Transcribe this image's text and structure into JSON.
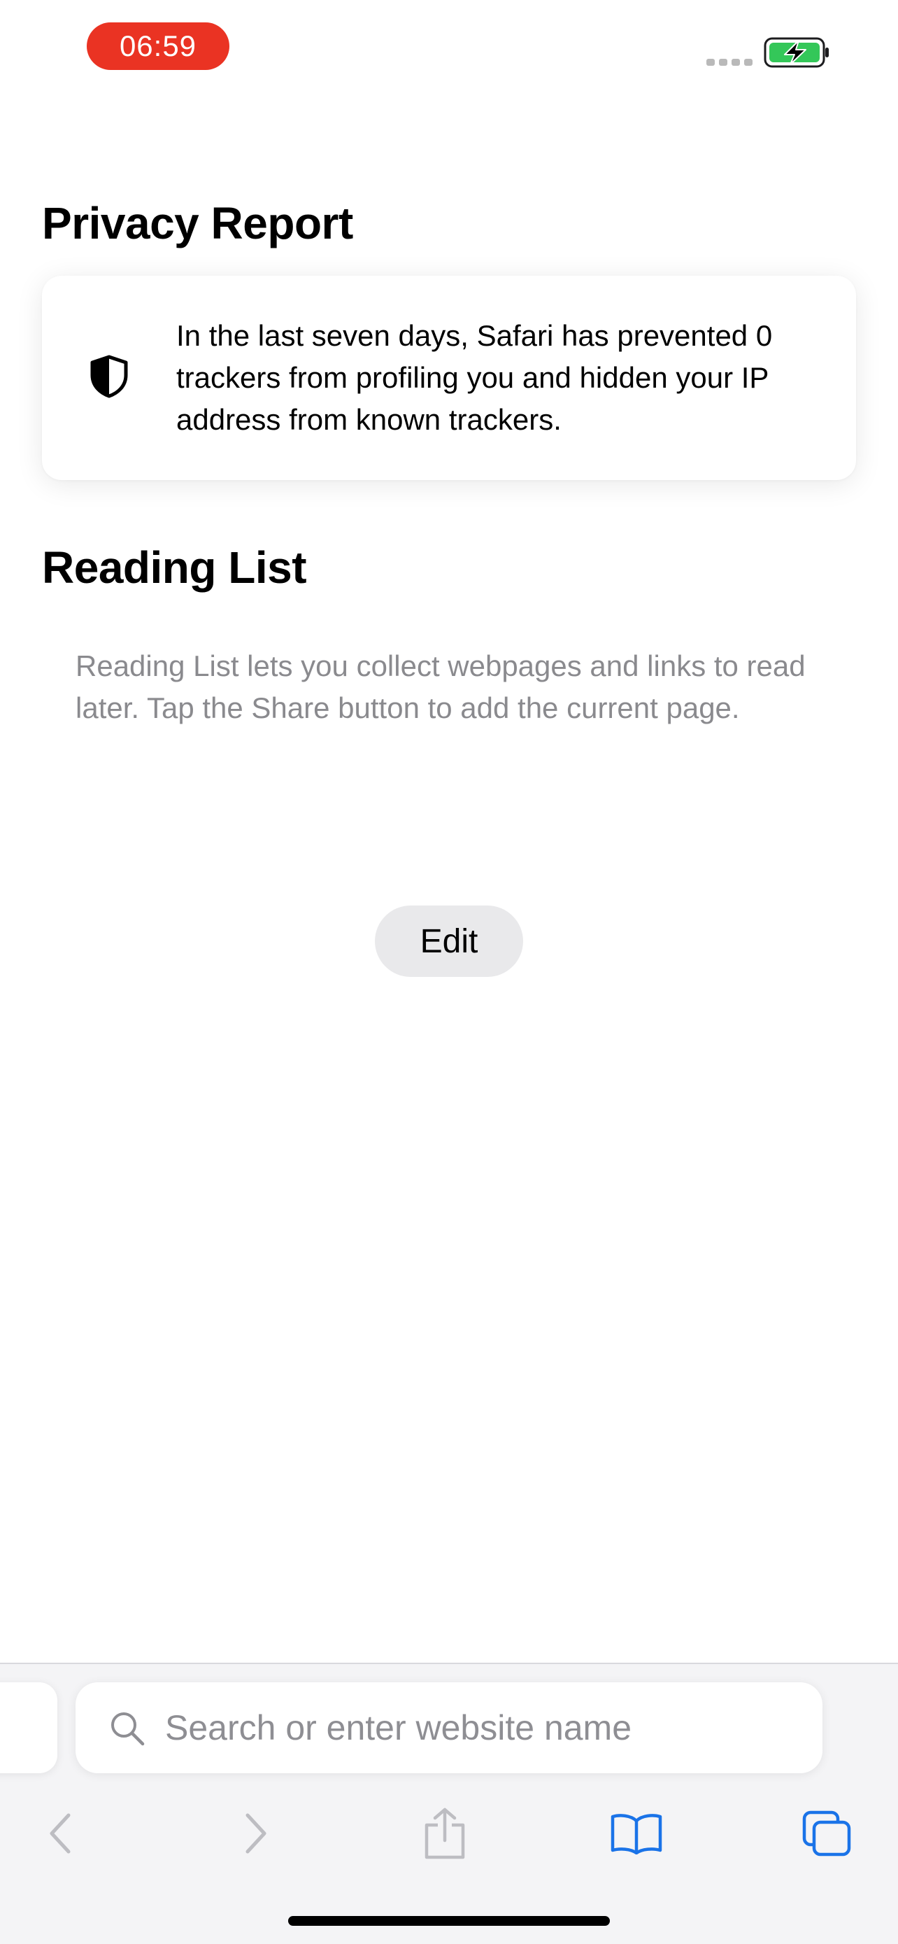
{
  "status_bar": {
    "time": "06:59",
    "time_pill_color": "#EA3323",
    "battery_color": "#34C759"
  },
  "privacy_report": {
    "title": "Privacy Report",
    "description": "In the last seven days, Safari has prevented 0 trackers from profiling you and hidden your IP address from known trackers.",
    "icon": "shield-icon"
  },
  "reading_list": {
    "title": "Reading List",
    "empty_message": "Reading List lets you collect webpages and links to read later. Tap the Share button to add the current page."
  },
  "edit_button": {
    "label": "Edit"
  },
  "address_bar": {
    "placeholder": "Search or enter website name",
    "value": "",
    "icon": "search-icon"
  },
  "toolbar": {
    "accent_color": "#1A73E8",
    "items": [
      {
        "name": "back",
        "icon": "chevron-left-icon",
        "enabled": false
      },
      {
        "name": "forward",
        "icon": "chevron-right-icon",
        "enabled": false
      },
      {
        "name": "share",
        "icon": "share-icon",
        "enabled": false
      },
      {
        "name": "bookmarks",
        "icon": "book-icon",
        "enabled": true
      },
      {
        "name": "tabs",
        "icon": "tabs-icon",
        "enabled": true
      }
    ]
  }
}
